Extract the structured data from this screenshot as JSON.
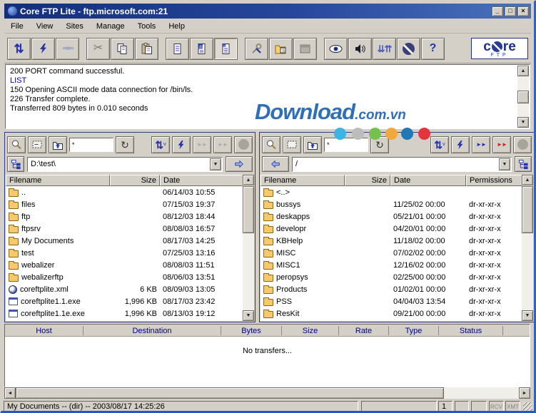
{
  "window": {
    "title": "Core FTP Lite - ftp.microsoft.com:21"
  },
  "titlebar": {
    "minimize": "_",
    "maximize": "□",
    "close": "×"
  },
  "menu": {
    "items": [
      "File",
      "View",
      "Sites",
      "Manage",
      "Tools",
      "Help"
    ]
  },
  "toolbar": {
    "glyphs": {
      "transfer": "⇅",
      "disconnect": "⇒⇐",
      "cut": "✂",
      "queue": "⇊⇈",
      "help": "?",
      "refresh": "↻",
      "transfer_small": "⇅",
      "transfer_small_v": "v",
      "upload_arrows": "►►",
      "download_arrows": "►►"
    },
    "logo": {
      "pre": "c",
      "post": "re",
      "sub": "FTP"
    }
  },
  "log": {
    "lines": [
      {
        "text": "200 PORT command successful.",
        "color": "#000000"
      },
      {
        "text": "LIST",
        "color": "#0000c0"
      },
      {
        "text": "150 Opening ASCII mode data connection for /bin/ls.",
        "color": "#000000"
      },
      {
        "text": "226 Transfer complete.",
        "color": "#000000"
      },
      {
        "text": "Transferred 809 bytes in 0.010 seconds",
        "color": "#000000"
      }
    ]
  },
  "watermark": {
    "text_main": "Download",
    "text_suffix": ".com.vn",
    "text_color": "#2f6fb8",
    "dots": [
      "#3cb4e5",
      "#bcbcbc",
      "#76c04c",
      "#f2a93b",
      "#2277b5",
      "#e4353f"
    ]
  },
  "left_panel": {
    "filter_value": "*",
    "path": "D:\\test\\",
    "columns": [
      "Filename",
      "Size",
      "Date"
    ],
    "rows": [
      {
        "name": "..",
        "size": "",
        "date": "06/14/03 10:55"
      },
      {
        "name": "files",
        "size": "",
        "date": "07/15/03 19:37"
      },
      {
        "name": "ftp",
        "size": "",
        "date": "08/12/03 18:44"
      },
      {
        "name": "ftpsrv",
        "size": "",
        "date": "08/08/03 16:57"
      },
      {
        "name": "My Documents",
        "size": "",
        "date": "08/17/03 14:25"
      },
      {
        "name": "test",
        "size": "",
        "date": "07/25/03 13:16"
      },
      {
        "name": "webalizer",
        "size": "",
        "date": "08/08/03 11:51"
      },
      {
        "name": "webalizerftp",
        "size": "",
        "date": "08/06/03 13:51"
      },
      {
        "name": "coreftplite.xml",
        "size": "6 KB",
        "date": "08/09/03 13:05"
      },
      {
        "name": "coreftplite1.1.exe",
        "size": "1,996 KB",
        "date": "08/17/03 23:42"
      },
      {
        "name": "coreftplite1.1e.exe",
        "size": "1,996 KB",
        "date": "08/13/03 19:12"
      }
    ]
  },
  "right_panel": {
    "filter_value": "*",
    "path": "/",
    "columns": [
      "Filename",
      "Size",
      "Date",
      "Permissions"
    ],
    "rows": [
      {
        "name": "<..>",
        "size": "",
        "date": "",
        "perm": ""
      },
      {
        "name": "bussys",
        "size": "",
        "date": "11/25/02 00:00",
        "perm": "dr-xr-xr-x"
      },
      {
        "name": "deskapps",
        "size": "",
        "date": "05/21/01 00:00",
        "perm": "dr-xr-xr-x"
      },
      {
        "name": "developr",
        "size": "",
        "date": "04/20/01 00:00",
        "perm": "dr-xr-xr-x"
      },
      {
        "name": "KBHelp",
        "size": "",
        "date": "11/18/02 00:00",
        "perm": "dr-xr-xr-x"
      },
      {
        "name": "MISC",
        "size": "",
        "date": "07/02/02 00:00",
        "perm": "dr-xr-xr-x"
      },
      {
        "name": "MISC1",
        "size": "",
        "date": "12/16/02 00:00",
        "perm": "dr-xr-xr-x"
      },
      {
        "name": "peropsys",
        "size": "",
        "date": "02/25/00 00:00",
        "perm": "dr-xr-xr-x"
      },
      {
        "name": "Products",
        "size": "",
        "date": "01/02/01 00:00",
        "perm": "dr-xr-xr-x"
      },
      {
        "name": "PSS",
        "size": "",
        "date": "04/04/03 13:54",
        "perm": "dr-xr-xr-x"
      },
      {
        "name": "ResKit",
        "size": "",
        "date": "09/21/00 00:00",
        "perm": "dr-xr-xr-x"
      }
    ]
  },
  "queue": {
    "columns": [
      "Host",
      "Destination",
      "Bytes",
      "Size",
      "Rate",
      "Type",
      "Status"
    ],
    "empty_text": "No transfers..."
  },
  "statusbar": {
    "text": "My Documents -- (dir) -- 2003/08/17 14:25:26",
    "counter": "1",
    "rcv": "RCV",
    "xmt": "XMT"
  }
}
